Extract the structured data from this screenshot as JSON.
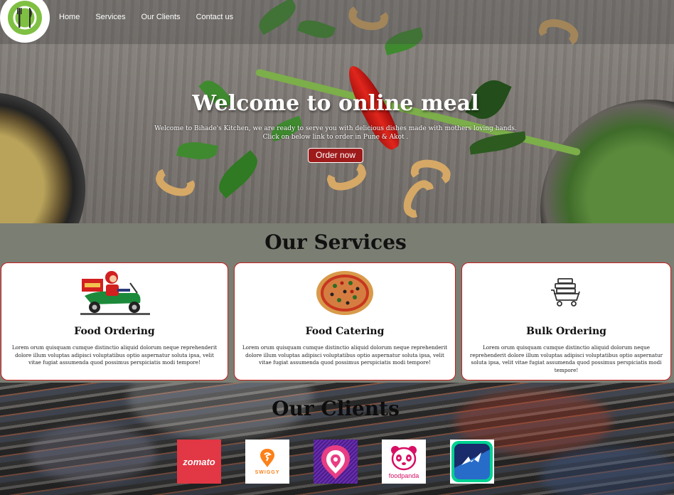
{
  "nav": {
    "logo_icon": "fork-knife-plate-icon",
    "links": [
      "Home",
      "Services",
      "Our Clients",
      "Contact us"
    ]
  },
  "hero": {
    "title": "Welcome to online meal",
    "line1": "Welcome to Bihade's Kitchen, we are ready to serve you with delicious dishes made with mothers loving hands.",
    "line2": "Click on below link to order in Pune & Akot .",
    "button": "Order now"
  },
  "services": {
    "title": "Our Services",
    "cards": [
      {
        "icon": "delivery-scooter-icon",
        "title": "Food Ordering",
        "text": "Lorem orum quisquam cumque distinctio aliquid dolorum neque reprehenderit dolore illum voluptas adipisci voluptatibus optio aspernatur soluta ipsa, velit vitae fugiat assumenda quod possimus perspiciatis modi tempore!"
      },
      {
        "icon": "pizza-icon",
        "title": "Food Catering",
        "text": "Lorem orum quisquam cumque distinctio aliquid dolorum neque reprehenderit dolore illum voluptas adipisci voluptatibus optio aspernatur soluta ipsa, velit vitae fugiat assumenda quod possimus perspiciatis modi tempore!"
      },
      {
        "icon": "cart-boxes-icon",
        "title": "Bulk Ordering",
        "text": "Lorem orum quisquam cumque distinctio aliquid dolorum neque reprehenderit dolore illum voluptas adipisci voluptatibus optio aspernatur soluta ipsa, velit vitae fugiat assumenda quod possimus perspiciatis modi tempore!"
      }
    ]
  },
  "clients": {
    "title": "Our Clients",
    "logos": [
      {
        "name": "zomato",
        "label": "zomato",
        "color": "#e23744"
      },
      {
        "name": "swiggy",
        "label": "SWIGGY",
        "color": "#fc8019"
      },
      {
        "name": "location-pin",
        "label": "",
        "color": "#4a1c87"
      },
      {
        "name": "foodpanda",
        "label": "foodpanda",
        "color": "#d70f64"
      },
      {
        "name": "dunzo",
        "label": "",
        "color": "#00d290"
      }
    ]
  },
  "colors": {
    "accent_red": "#9e1b1b",
    "card_border": "#c41e1e",
    "services_bg": "#7b7e73"
  }
}
